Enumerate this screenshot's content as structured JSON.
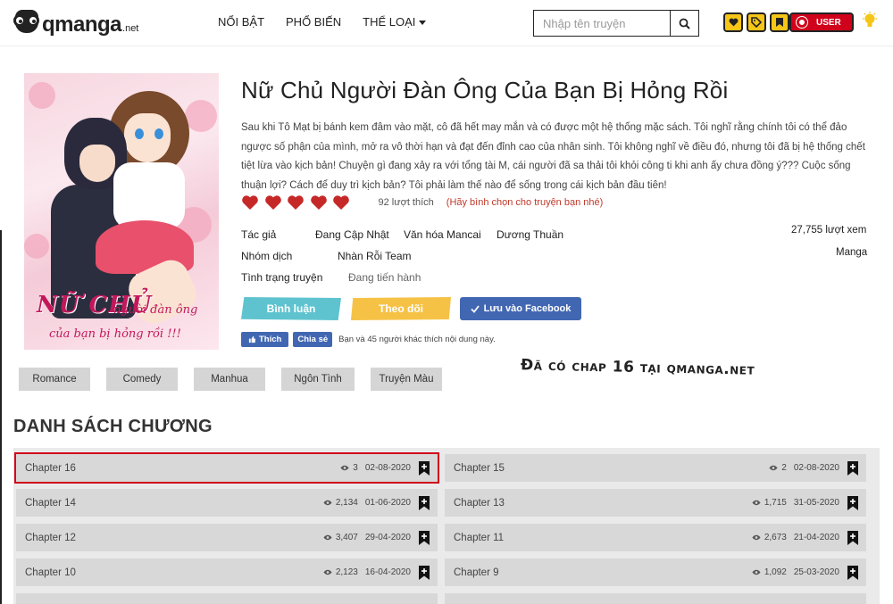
{
  "header": {
    "logo_text": "qmanga",
    "logo_ext": ".net",
    "nav": [
      {
        "label": "NỔI BẬT"
      },
      {
        "label": "PHỔ BIẾN"
      },
      {
        "label": "THỂ LOẠI"
      }
    ],
    "search_placeholder": "Nhập tên truyện",
    "user_label": "USER"
  },
  "manga": {
    "cover_title_main": "NỮ CHỦ",
    "cover_title_sub": "người đàn ông",
    "cover_title_line2": "của bạn bị hỏng rồi !!!",
    "title": "Nữ Chủ Người Đàn Ông Của Bạn Bị Hỏng Rồi",
    "description": "Sau khi Tô Mạt bị bánh kem đâm vào mặt, cô đã hết may mắn và có được một hệ thống mặc sách. Tôi nghĩ rằng chính tôi có thể đảo ngược số phận của mình, mở ra vô thời hạn và đạt đến đỉnh cao của nhân sinh. Tôi không nghĩ về điều đó, nhưng tôi đã bị hệ thống chết tiệt lừa vào kịch bản! Chuyện gì đang xảy ra với tổng tài M, cái người đã sa thải tôi khỏi công ti khi anh ấy chưa đồng ý??? Cuộc sống thuận lợi? Cách để duy trì kịch bản? Tôi phải làm thế nào để sống trong cái kịch bản đầu tiên!",
    "rating_hearts": 5,
    "likes": "92 lượt thích",
    "vote_prompt": "(Hãy bình chọn cho truyện bạn nhé)",
    "author_label": "Tác giả",
    "authors": [
      "Đang Cập Nhật",
      "Văn hóa Mancai",
      "Dương Thuần"
    ],
    "group_label": "Nhóm dịch",
    "group": "Nhàn Rỗi Team",
    "status_label": "Tình trạng truyện",
    "status": "Đang tiến hành",
    "views": "27,755  lượt xem",
    "kind": "Manga",
    "comment_btn": "Bình luận",
    "follow_btn": "Theo dõi",
    "fb_save_btn": "Lưu vào Facebook",
    "fb_like": "Thích",
    "fb_share": "Chia sẻ",
    "fb_text": "Bạn và 45 người khác thích nội dung này.",
    "genres": [
      "Romance",
      "Comedy",
      "Manhua",
      "Ngôn Tình",
      "Truyện Màu"
    ],
    "notice": "Đã có chap 16 tại qmanga.net"
  },
  "chapters_title": "DANH SÁCH CHƯƠNG",
  "chapters": [
    {
      "name": "Chapter 16",
      "views": "3",
      "date": "02-08-2020"
    },
    {
      "name": "Chapter 15",
      "views": "2",
      "date": "02-08-2020"
    },
    {
      "name": "Chapter 14",
      "views": "2,134",
      "date": "01-06-2020"
    },
    {
      "name": "Chapter 13",
      "views": "1,715",
      "date": "31-05-2020"
    },
    {
      "name": "Chapter 12",
      "views": "3,407",
      "date": "29-04-2020"
    },
    {
      "name": "Chapter 11",
      "views": "2,673",
      "date": "21-04-2020"
    },
    {
      "name": "Chapter 10",
      "views": "2,123",
      "date": "16-04-2020"
    },
    {
      "name": "Chapter 9",
      "views": "1,092",
      "date": "25-03-2020"
    }
  ],
  "colors": {
    "accent_red": "#d0021b",
    "heart_red": "#c62828",
    "comment_teal": "#5ec3cf",
    "follow_yellow": "#f6c246",
    "facebook_blue": "#4267b2",
    "icon_yellow": "#f5c518"
  }
}
